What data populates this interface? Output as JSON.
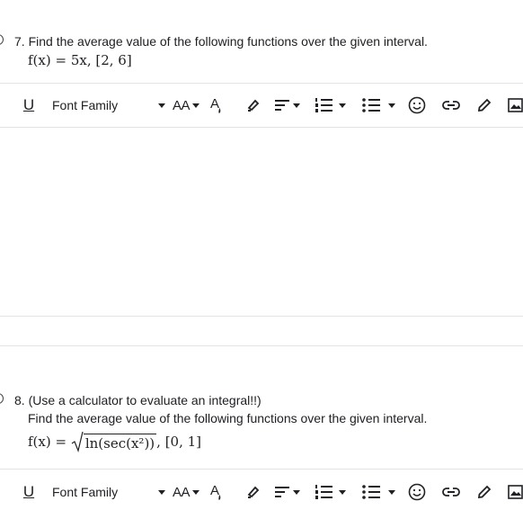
{
  "question7": {
    "number_text": "7. Find the average value of the following functions over the given interval.",
    "math_fx": "f(x) = 5x, [2, 6]"
  },
  "question8": {
    "number_text": "8. (Use a calculator to evaluate an integral!!)",
    "line2": "Find the average value of the following functions over the given interval.",
    "math_prefix": "f(x) = ",
    "math_radicand": "ln(sec(x²))",
    "math_suffix": ", [0, 1]"
  },
  "toolbar": {
    "underline_label": "U",
    "font_family_label": "Font Family",
    "font_size_label": "AA",
    "icons": [
      "underline-icon",
      "font-family-dropdown",
      "font-size-icon",
      "text-color-icon",
      "highlight-icon",
      "align-icon",
      "numbered-list-icon",
      "bulleted-list-icon",
      "emoji-icon",
      "link-icon",
      "pencil-icon",
      "image-icon"
    ]
  }
}
